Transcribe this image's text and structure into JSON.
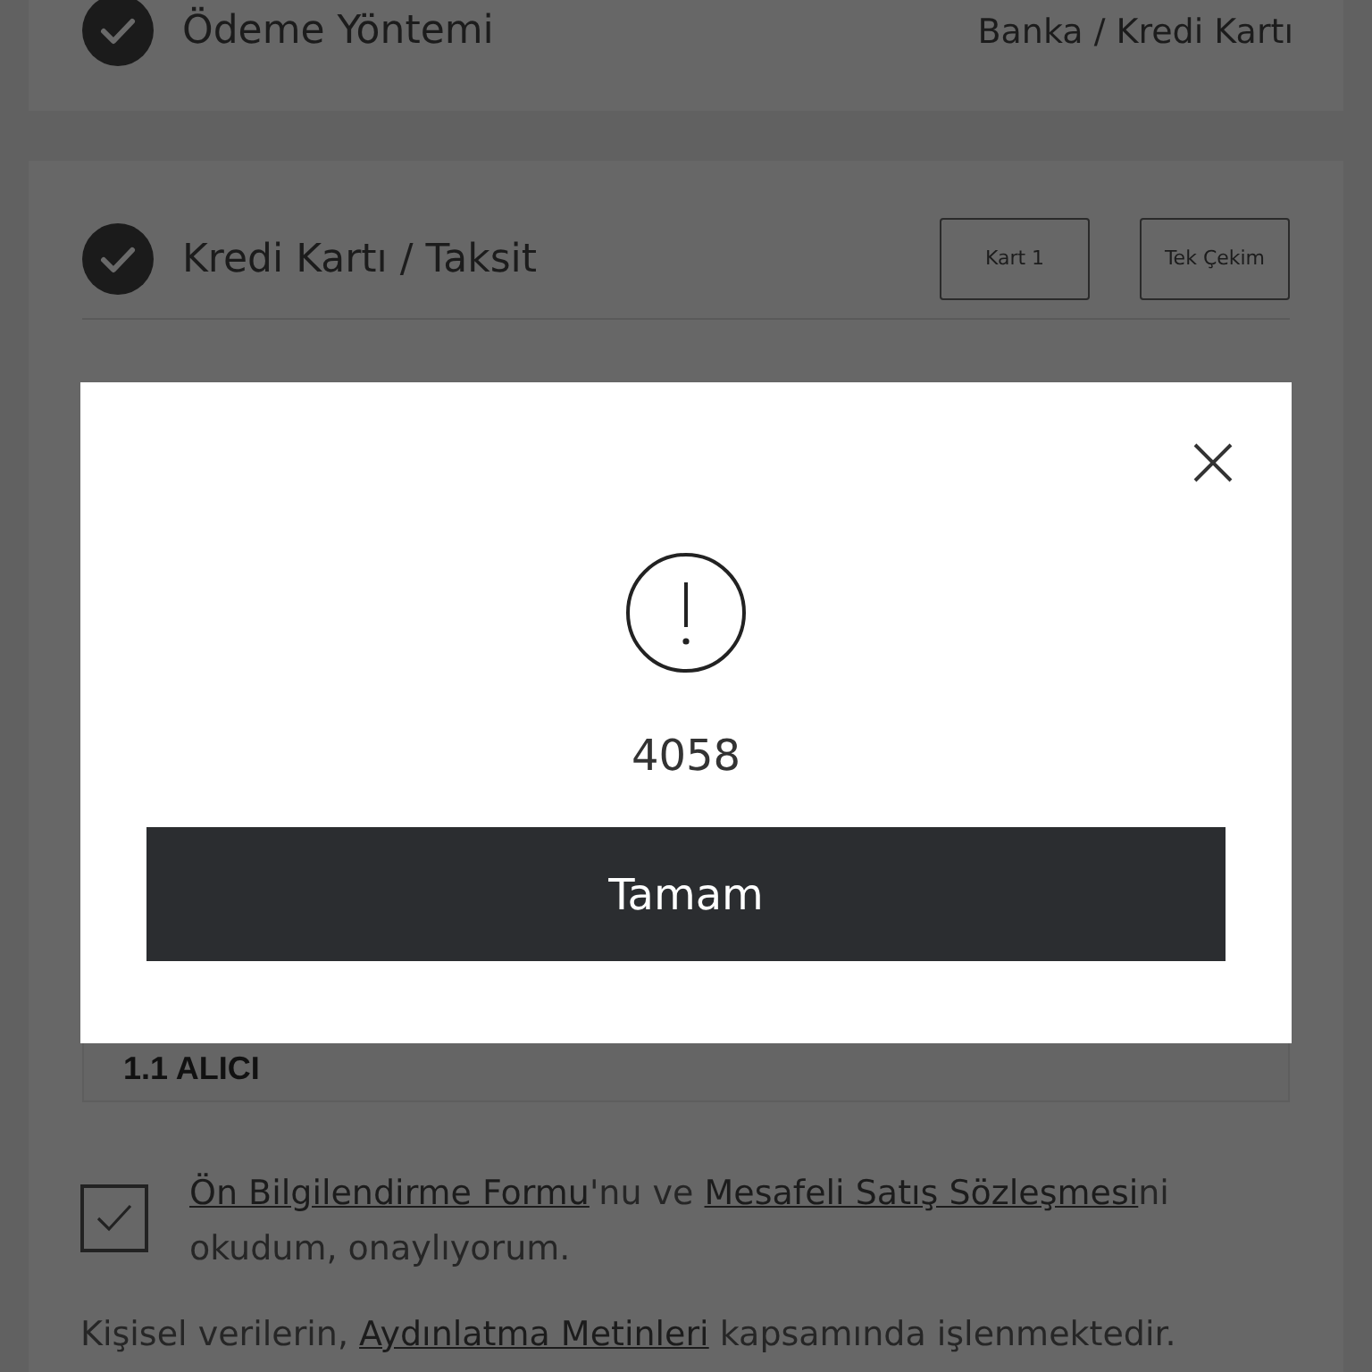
{
  "payment_method": {
    "title": "Ödeme Yöntemi",
    "value": "Banka / Kredi Kartı",
    "done": true
  },
  "card_section": {
    "title": "Kredi Kartı / Taksit",
    "done": true,
    "options": [
      "Kart 1",
      "Tek Çekim"
    ]
  },
  "dialog": {
    "message": "4058",
    "button": "Tamam"
  },
  "section_heading": "1.1 ALICI",
  "consent": {
    "checked": true,
    "parts": [
      {
        "kind": "link",
        "text": "Ön Bilgilendirme Formu"
      },
      {
        "kind": "text",
        "text": "'nu ve "
      },
      {
        "kind": "link",
        "text": "Mesafeli Satış Sözleşmesi"
      },
      {
        "kind": "text",
        "text": "ni okudum, onaylıyorum."
      }
    ]
  },
  "privacy_note": {
    "parts": [
      {
        "kind": "text",
        "text": "Kişisel verilerin, "
      },
      {
        "kind": "link",
        "text": "Aydınlatma Metinleri"
      },
      {
        "kind": "text",
        "text": " kapsamında işlenmektedir."
      }
    ]
  }
}
